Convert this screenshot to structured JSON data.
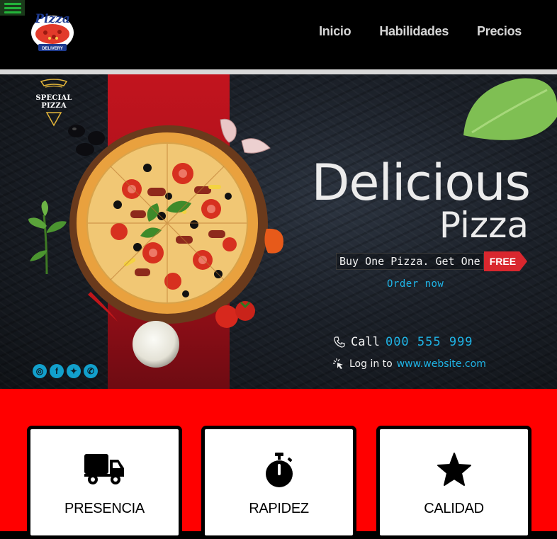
{
  "header": {
    "menu_icon": "hamburger-icon",
    "logo": {
      "script_text": "Pizza",
      "badge_text": "DELIVERY"
    },
    "nav": [
      "Inicio",
      "Habilidades",
      "Precios"
    ]
  },
  "hero": {
    "special_label": "SPECIAL PIZZA",
    "title_line1": "Delicious",
    "title_line2": "Pizza",
    "offer_text": "Buy One Pizza. Get One",
    "offer_badge": "FREE",
    "order_cta": "Order now",
    "call_label": "Call",
    "phone": "000 555 999",
    "login_label": "Log in to",
    "website": "www.website.com",
    "social_icons": [
      "instagram-icon",
      "facebook-icon",
      "twitter-icon",
      "whatsapp-icon"
    ]
  },
  "features": [
    {
      "title": "PRESENCIA",
      "icon": "truck-icon"
    },
    {
      "title": "RAPIDEZ",
      "icon": "stopwatch-icon"
    },
    {
      "title": "CALIDAD",
      "icon": "star-icon"
    }
  ],
  "colors": {
    "header_bg": "#000000",
    "nav_text": "#d6d6d6",
    "features_bg": "#ff0000",
    "accent_blue": "#1fb4e6",
    "badge_red": "#d9272e",
    "menu_green": "#23b33a"
  }
}
